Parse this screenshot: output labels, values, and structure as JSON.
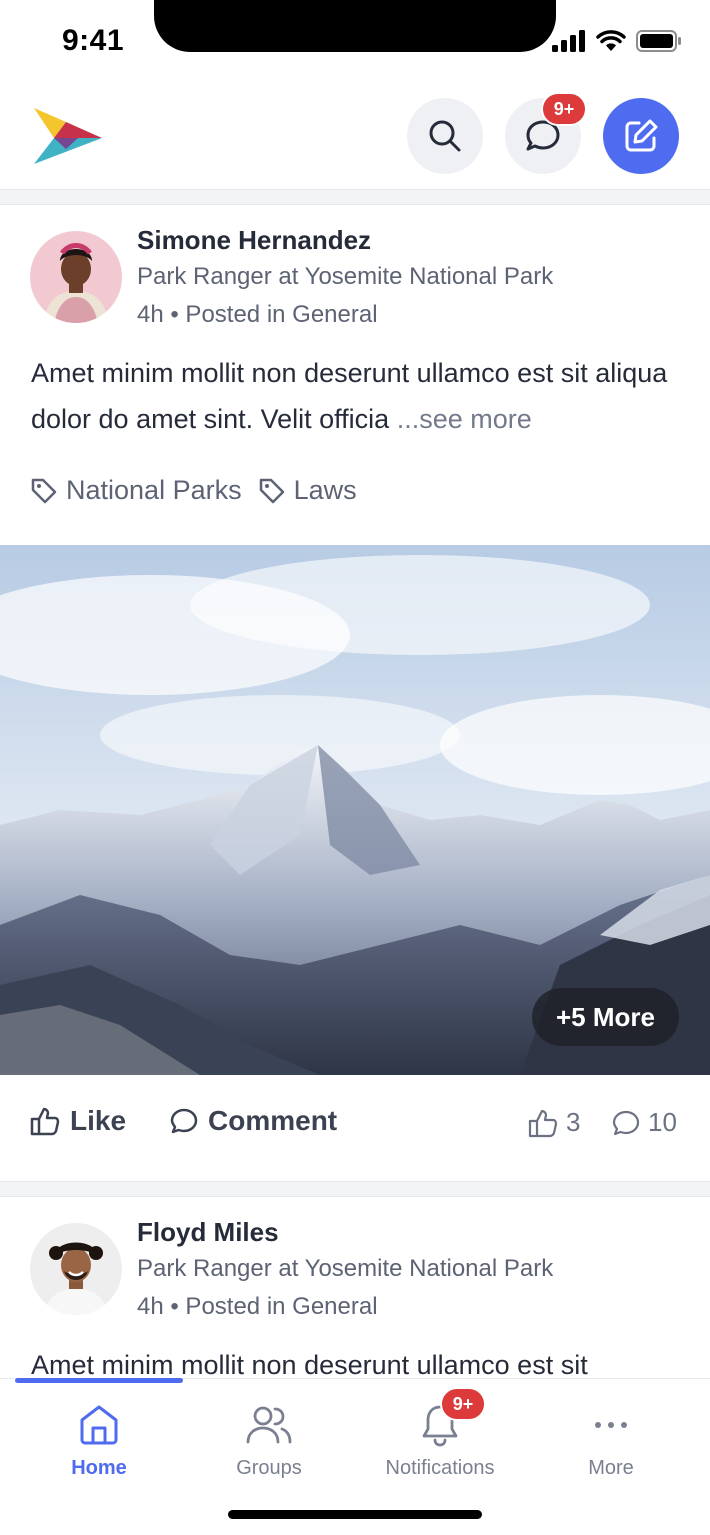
{
  "status_bar": {
    "time": "9:41"
  },
  "header": {
    "logo": "app-logo",
    "search_icon": "search-icon",
    "messages_icon": "chat-icon",
    "messages_badge": "9+",
    "compose_icon": "edit-icon"
  },
  "posts": [
    {
      "author": "Simone Hernandez",
      "title": "Park Ranger at Yosemite National Park",
      "meta": "4h • Posted in General",
      "text": "Amet minim mollit non deserunt ullamco est sit aliqua dolor do amet sint. Velit officia ",
      "see_more": "...see more",
      "tags": [
        "National Parks",
        "Laws"
      ],
      "more_photos": "+5 More",
      "like_label": "Like",
      "comment_label": "Comment",
      "likes": "3",
      "comments": "10"
    },
    {
      "author": "Floyd Miles",
      "title": "Park Ranger at Yosemite National Park",
      "meta": "4h • Posted in General",
      "text": "Amet minim mollit non deserunt ullamco est sit"
    }
  ],
  "tabs": [
    {
      "label": "Home",
      "icon": "home-icon",
      "active": true
    },
    {
      "label": "Groups",
      "icon": "users-icon"
    },
    {
      "label": "Notifications",
      "icon": "bell-icon",
      "badge": "9+"
    },
    {
      "label": "More",
      "icon": "more-icon"
    }
  ],
  "colors": {
    "accent": "#4f6cf0",
    "badge": "#dd3b3b"
  }
}
